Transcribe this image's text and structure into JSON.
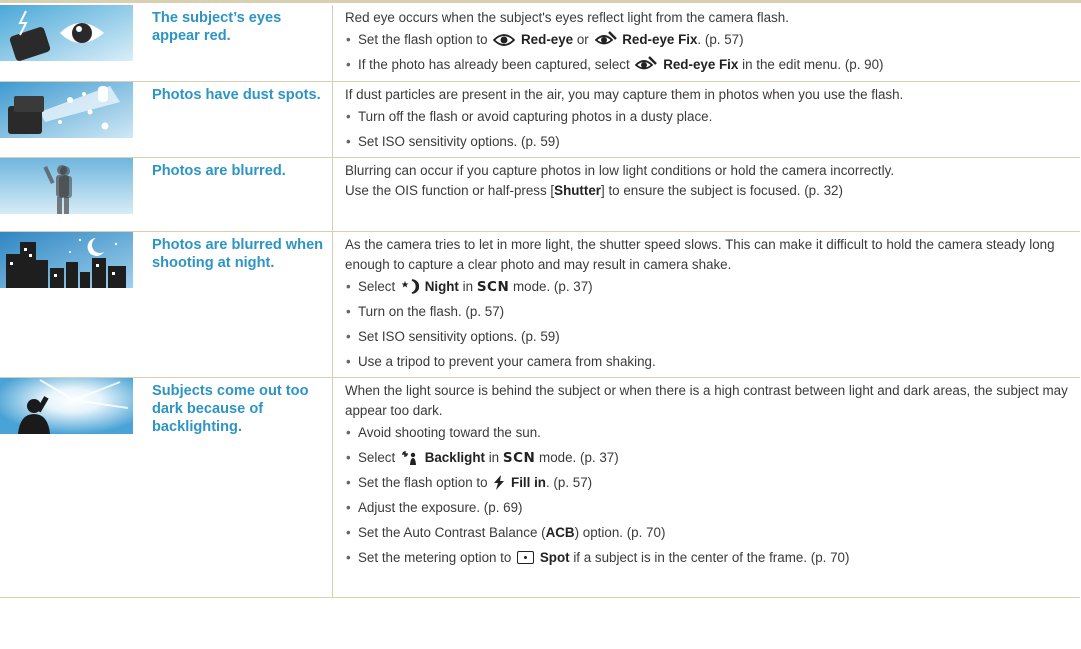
{
  "icons": {
    "red_eye": "eye-icon",
    "red_eye_fix": "red-eye-fix-icon",
    "night": "night-icon",
    "backlight": "backlight-icon",
    "fill_in": "flash-icon",
    "spot": "spot-metering-icon"
  },
  "colors": {
    "title": "#2d95c5",
    "rule": "#d9d0b4",
    "text": "#3a3a3a"
  },
  "rows": [
    {
      "title": "The subject’s eyes appear red.",
      "intro": "Red eye occurs when the subject's eyes reflect light from the camera flash.",
      "b1_pre": "Set the flash option to",
      "b1_red": "Red-eye",
      "b1_or": "or",
      "b1_fix": "Red-eye Fix",
      "b1_post": ". (p. 57)",
      "b2_pre": "If the photo has already been captured, select",
      "b2_fix": "Red-eye Fix",
      "b2_post": "in the edit menu. (p. 90)"
    },
    {
      "title": "Photos have dust spots.",
      "intro": "If dust particles are present in the air, you may capture them in photos when you use the flash.",
      "b1": "Turn off the flash or avoid capturing photos in a dusty place.",
      "b2": "Set ISO sensitivity options. (p. 59)"
    },
    {
      "title": "Photos are blurred.",
      "line1": "Blurring can occur if you capture photos in low light conditions or hold the camera incorrectly.",
      "line2_pre": "Use the OIS function or half-press [",
      "line2_key": "Shutter",
      "line2_post": "] to ensure the subject is focused. (p. 32)"
    },
    {
      "title": "Photos are blurred when shooting at night.",
      "intro": "As the camera tries to let in more light, the shutter speed slows. This can make it difficult to hold the camera steady long enough to capture a clear photo and may result in camera shake.",
      "b1_pre": "Select",
      "b1_night": "Night",
      "b1_in": "in",
      "b1_scn": "SCN",
      "b1_post": "mode. (p. 37)",
      "b2": "Turn on the flash. (p. 57)",
      "b3": "Set ISO sensitivity options. (p. 59)",
      "b4": "Use a tripod to prevent your camera from shaking."
    },
    {
      "title": "Subjects come out too dark because of backlighting.",
      "intro": "When the light source is behind the subject or when there is a high contrast between light and dark areas, the subject may appear too dark.",
      "b1": "Avoid shooting toward the sun.",
      "b2_pre": "Select",
      "b2_backlight": "Backlight",
      "b2_in": "in",
      "b2_scn": "SCN",
      "b2_post": "mode. (p. 37)",
      "b3_pre": "Set the flash option to",
      "b3_fill": "Fill in",
      "b3_post": ". (p. 57)",
      "b4": "Adjust the exposure. (p. 69)",
      "b5_pre": "Set the Auto Contrast Balance (",
      "b5_acb": "ACB",
      "b5_post": ") option. (p. 70)",
      "b6_pre": "Set the metering option to",
      "b6_spot": "Spot",
      "b6_post": "if a subject is in the center of the frame. (p. 70)"
    }
  ]
}
